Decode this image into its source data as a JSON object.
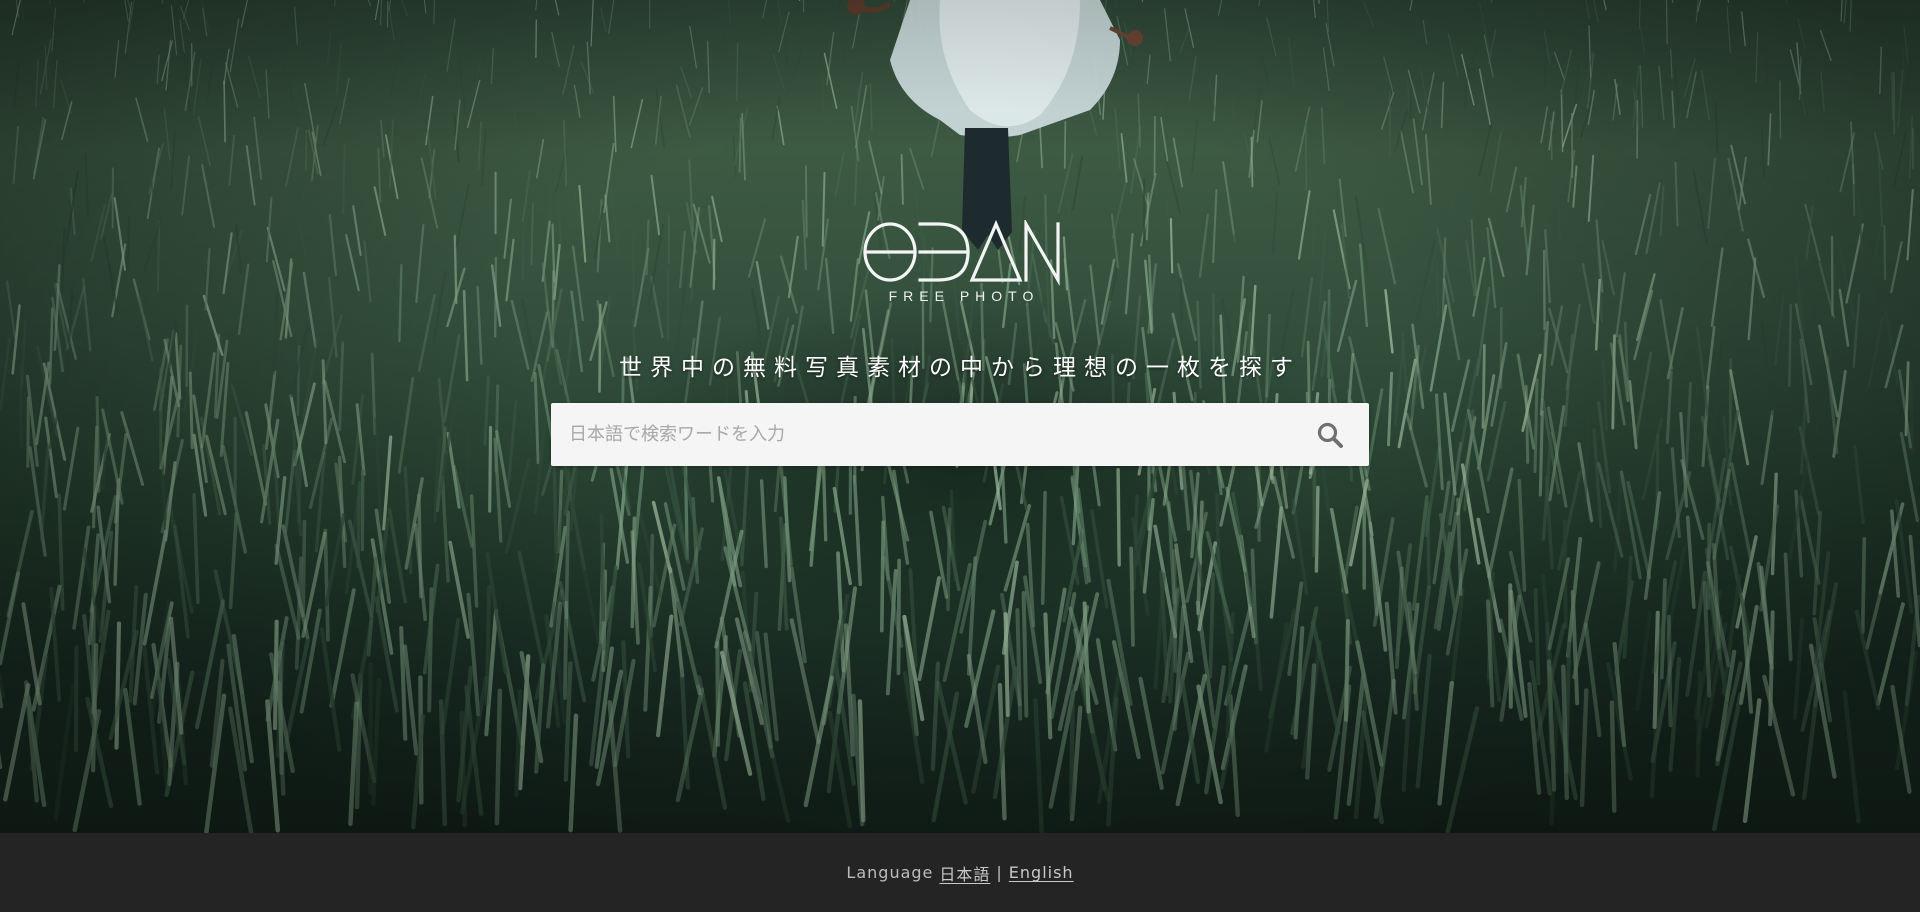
{
  "logo": {
    "wordmark": "ODAN",
    "subtitle": "FREE PHOTO"
  },
  "tagline": "世界中の無料写真素材の中から理想の一枚を探す",
  "search": {
    "placeholder": "日本語で検索ワードを入力",
    "value": "",
    "button_icon": "search-icon"
  },
  "footer": {
    "language_label": "Language",
    "languages": [
      {
        "label": "日本語"
      },
      {
        "label": "English"
      }
    ],
    "separator": "|"
  },
  "colors": {
    "footer_bg": "#242424",
    "search_bg": "#f5f5f5",
    "icon": "#6f6f6f"
  }
}
